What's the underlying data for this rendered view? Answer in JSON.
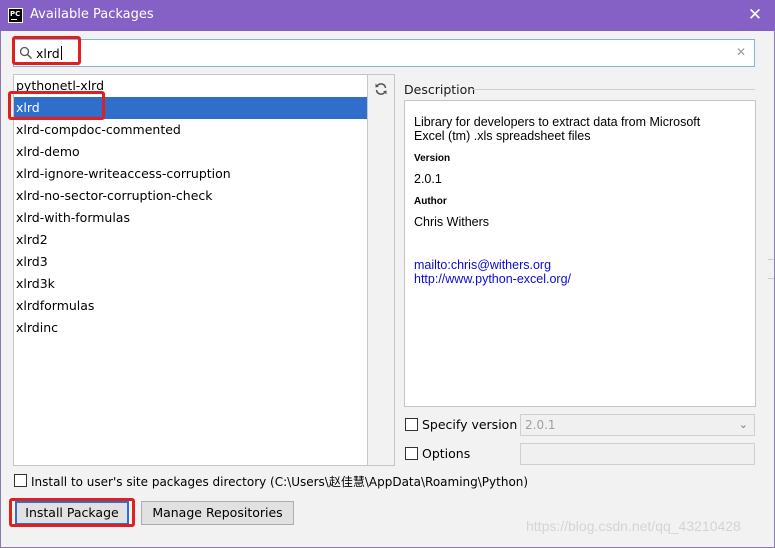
{
  "window": {
    "title": "Available Packages",
    "app_icon_text": "PC",
    "close_glyph": "✕"
  },
  "search": {
    "value": "xlrd",
    "clear_glyph": "✕"
  },
  "packages": [
    "pythonetl-xlrd",
    "xlrd",
    "xlrd-compdoc-commented",
    "xlrd-demo",
    "xlrd-ignore-writeaccess-corruption",
    "xlrd-no-sector-corruption-check",
    "xlrd-with-formulas",
    "xlrd2",
    "xlrd3",
    "xlrd3k",
    "xlrdformulas",
    "xlrdinc"
  ],
  "selected_package": "xlrd",
  "description": {
    "label": "Description",
    "summary": "Library for developers to extract data from Microsoft Excel (tm) .xls spreadsheet files",
    "version_label": "Version",
    "version": "2.0.1",
    "author_label": "Author",
    "author": "Chris Withers",
    "email_link": "mailto:chris@withers.org",
    "homepage_link": "http://www.python-excel.org/"
  },
  "options": {
    "specify_version_label": "Specify version",
    "specify_version_value": "2.0.1",
    "options_label": "Options",
    "install_user_label": "Install to user's site packages directory (C:\\Users\\赵佳慧\\AppData\\Roaming\\Python)"
  },
  "buttons": {
    "install": "Install Package",
    "manage": "Manage Repositories"
  },
  "watermark": "https://blog.csdn.net/qq_43210428",
  "colors": {
    "titlebar": "#8561c5",
    "selection": "#2f6fcb",
    "annotation": "#e02020",
    "link": "#0b0bd6"
  },
  "icons": {
    "app": "pycharm-icon",
    "search": "search-icon",
    "refresh": "refresh-icon",
    "close": "close-icon",
    "dropdown": "chevron-down-icon"
  }
}
